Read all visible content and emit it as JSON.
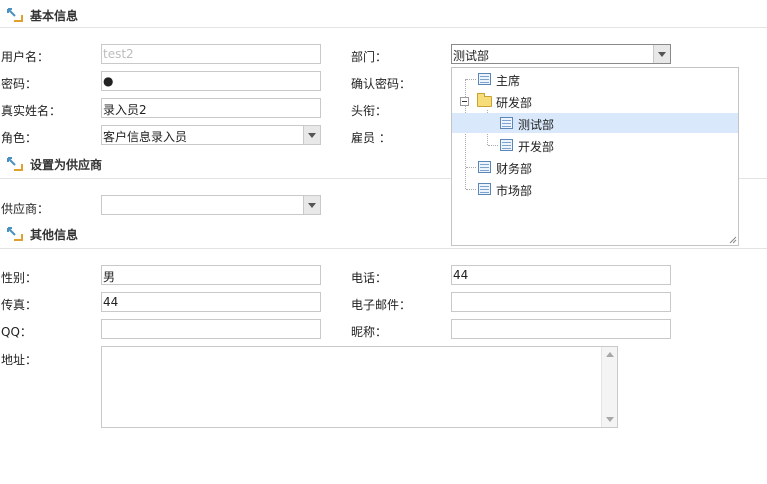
{
  "sections": {
    "basic": "基本信息",
    "supplier": "设置为供应商",
    "other": "其他信息"
  },
  "basic": {
    "username": {
      "label": "用户名：",
      "value": "test2"
    },
    "password": {
      "label": "密码：",
      "value": "●"
    },
    "realname": {
      "label": "真实姓名：",
      "value": "录入员2"
    },
    "role": {
      "label": "角色：",
      "value": "客户信息录入员"
    },
    "department": {
      "label": "部门：",
      "value": "测试部"
    },
    "confirm_password": {
      "label": "确认密码："
    },
    "title": {
      "label": "头衔："
    },
    "employee": {
      "label": "雇员 ："
    }
  },
  "department_tree": {
    "nodes": [
      {
        "label": "主席",
        "icon": "document-icon"
      },
      {
        "label": "研发部",
        "icon": "folder-open-icon",
        "expanded": true
      },
      {
        "label": "测试部",
        "icon": "document-icon",
        "selected": true
      },
      {
        "label": "开发部",
        "icon": "document-icon"
      },
      {
        "label": "财务部",
        "icon": "document-icon"
      },
      {
        "label": "市场部",
        "icon": "document-icon"
      }
    ]
  },
  "supplier": {
    "label": "供应商：",
    "value": ""
  },
  "other": {
    "gender": {
      "label": "性别：",
      "value": "男"
    },
    "fax": {
      "label": "传真：",
      "value": "44"
    },
    "qq": {
      "label": "QQ：",
      "value": ""
    },
    "address": {
      "label": "地址：",
      "value": ""
    },
    "phone": {
      "label": "电话：",
      "value": "44"
    },
    "email": {
      "label": "电子邮件：",
      "value": ""
    },
    "nickname": {
      "label": "昵称：",
      "value": ""
    }
  },
  "colors": {
    "selection": "#d9e8fb",
    "border": "#c9c9c9",
    "disabled_text": "#bdbdbd"
  }
}
